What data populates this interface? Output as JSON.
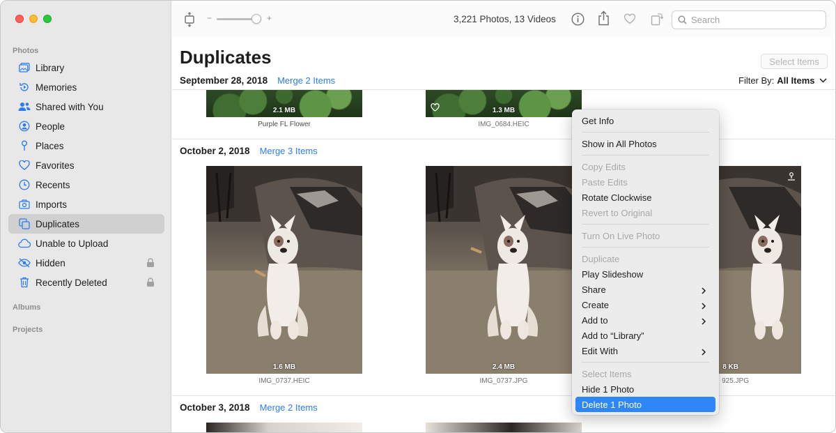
{
  "sidebar": {
    "sections": {
      "photos": "Photos",
      "albums": "Albums",
      "projects": "Projects"
    },
    "items": [
      {
        "label": "Library",
        "icon": "library-icon"
      },
      {
        "label": "Memories",
        "icon": "memories-icon"
      },
      {
        "label": "Shared with You",
        "icon": "shared-with-you-icon"
      },
      {
        "label": "People",
        "icon": "people-icon"
      },
      {
        "label": "Places",
        "icon": "places-icon"
      },
      {
        "label": "Favorites",
        "icon": "heart-icon"
      },
      {
        "label": "Recents",
        "icon": "clock-icon"
      },
      {
        "label": "Imports",
        "icon": "imports-icon"
      },
      {
        "label": "Duplicates",
        "icon": "duplicates-icon",
        "selected": true
      },
      {
        "label": "Unable to Upload",
        "icon": "cloud-icon"
      },
      {
        "label": "Hidden",
        "icon": "eye-slash-icon",
        "locked": true
      },
      {
        "label": "Recently Deleted",
        "icon": "trash-icon",
        "locked": true
      }
    ]
  },
  "toolbar": {
    "zoom_minus": "−",
    "zoom_plus": "+",
    "photo_count": "3,221 Photos, 13 Videos",
    "search_placeholder": "Search"
  },
  "main": {
    "title": "Duplicates",
    "select_items": "Select Items",
    "filter_label": "Filter By:",
    "filter_value": "All Items",
    "groups": [
      {
        "date": "September 28, 2018",
        "merge": "Merge 2 Items",
        "items": [
          {
            "size": "2.1 MB",
            "name": "Purple FL Flower"
          },
          {
            "size": "1.3 MB",
            "name": "IMG_0684.HEIC"
          }
        ]
      },
      {
        "date": "October 2, 2018",
        "merge": "Merge 3 Items",
        "items": [
          {
            "size": "1.6 MB",
            "name": "IMG_0737.HEIC"
          },
          {
            "size": "2.4 MB",
            "name": "IMG_0737.JPG"
          },
          {
            "size": "8 KB",
            "name": "925.JPG"
          }
        ]
      },
      {
        "date": "October 3, 2018",
        "merge": "Merge 2 Items",
        "items": []
      }
    ]
  },
  "context_menu": {
    "items": [
      {
        "label": "Get Info"
      },
      {
        "sep": true
      },
      {
        "label": "Show in All Photos"
      },
      {
        "sep": true
      },
      {
        "label": "Copy Edits",
        "disabled": true
      },
      {
        "label": "Paste Edits",
        "disabled": true
      },
      {
        "label": "Rotate Clockwise"
      },
      {
        "label": "Revert to Original",
        "disabled": true
      },
      {
        "sep": true
      },
      {
        "label": "Turn On Live Photo",
        "disabled": true
      },
      {
        "sep": true
      },
      {
        "label": "Duplicate",
        "disabled": true
      },
      {
        "label": "Play Slideshow"
      },
      {
        "label": "Share",
        "submenu": true
      },
      {
        "label": "Create",
        "submenu": true
      },
      {
        "label": "Add to",
        "submenu": true
      },
      {
        "label": "Add to “Library”"
      },
      {
        "label": "Edit With",
        "submenu": true
      },
      {
        "sep": true
      },
      {
        "label": "Select Items",
        "disabled": true
      },
      {
        "label": "Hide 1 Photo"
      },
      {
        "label": "Delete 1 Photo",
        "highlighted": true
      }
    ]
  },
  "colors": {
    "accent": "#2b7cf6",
    "highlight": "#2f86f7",
    "sidebar_bg": "#e8e8e8"
  }
}
